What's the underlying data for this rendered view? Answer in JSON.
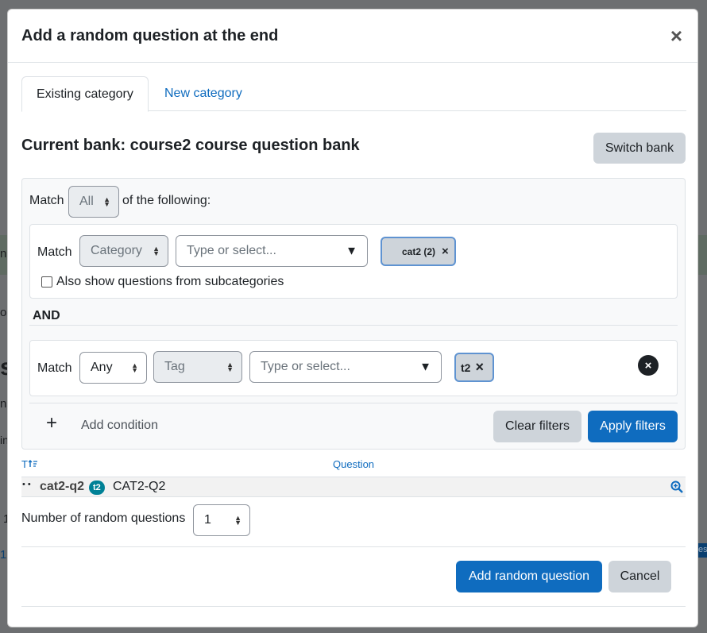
{
  "modal": {
    "title": "Add a random question at the end",
    "close_glyph": "×"
  },
  "tabs": [
    {
      "label": "Existing category",
      "active": true
    },
    {
      "label": "New category",
      "active": false
    }
  ],
  "bank": {
    "title": "Current bank: course2 course question bank",
    "switch_label": "Switch bank"
  },
  "filters": {
    "match_label": "Match",
    "match_value": "All",
    "of_following": "of the following:",
    "conditions": [
      {
        "match_label": "Match",
        "type_value": "Category",
        "combo_placeholder": "Type or select...",
        "chip": "cat2 (2)",
        "chip_remove": "×",
        "subcat_label": "Also show questions from subcategories"
      },
      {
        "match_label": "Match",
        "join_value": "Any",
        "type_value": "Tag",
        "combo_placeholder": "Type or select...",
        "chip": "t2",
        "chip_remove": "×",
        "remove_glyph": "×"
      }
    ],
    "and_label": "AND",
    "add_condition_plus": "+",
    "add_condition": "Add condition",
    "clear_label": "Clear filters",
    "apply_label": "Apply filters"
  },
  "table": {
    "col_type": "T",
    "col_question": "Question",
    "rows": [
      {
        "dots": "• •",
        "name": "cat2-q2",
        "tag": "t2",
        "text": "CAT2-Q2"
      }
    ]
  },
  "random": {
    "label": "Number of random questions",
    "value": "1"
  },
  "footer": {
    "add_label": "Add random question",
    "cancel_label": "Cancel"
  },
  "background": {
    "frag1": "n",
    "frag2": "o",
    "frag3": "s",
    "frag4": "ns",
    "frag5": "in",
    "frag6": "1",
    "frag7": "1",
    "frag8": "es"
  },
  "colors": {
    "primary": "#0f6cbf",
    "secondary": "#ced4da",
    "badge": "#008196",
    "backdrop": "#6d6f71"
  }
}
